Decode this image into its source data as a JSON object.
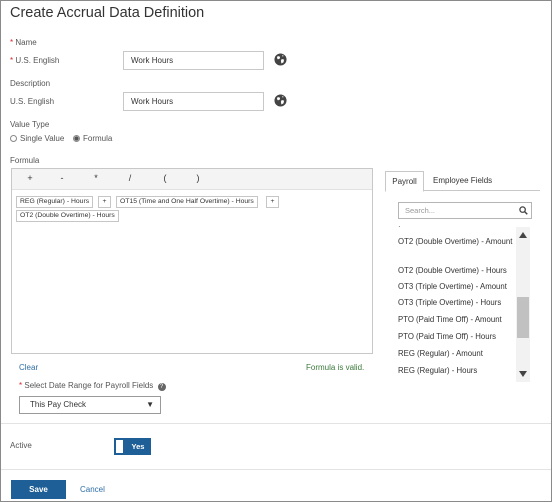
{
  "page": {
    "title": "Create Accrual Data Definition"
  },
  "name": {
    "section_label": "Name",
    "field_label": "U.S. English",
    "value": "Work Hours"
  },
  "description": {
    "section_label": "Description",
    "field_label": "U.S. English",
    "value": "Work Hours"
  },
  "value_type": {
    "label": "Value Type",
    "options": [
      "Single Value",
      "Formula"
    ],
    "selected": "Formula"
  },
  "formula": {
    "label": "Formula",
    "operators": [
      "+",
      "-",
      "*",
      "/",
      "(",
      ")"
    ],
    "tokens": [
      "REG (Regular) - Hours",
      "+",
      "OT15 (Time and One Half Overtime) - Hours",
      "+",
      "OT2 (Double Overtime) - Hours"
    ],
    "clear_label": "Clear",
    "status": "Formula is valid."
  },
  "date_range": {
    "label": "Select Date Range for Payroll Fields",
    "help": "?",
    "value": "This Pay Check",
    "caret": "▼"
  },
  "field_panel": {
    "tabs": [
      "Payroll",
      "Employee Fields"
    ],
    "active_tab": "Payroll",
    "search_placeholder": "Search...",
    "partial_item": "·",
    "items": [
      "OT2 (Double Overtime) - Amount",
      "OT2 (Double Overtime) - Hours",
      "OT3 (Triple Overtime) - Amount",
      "OT3 (Triple Overtime) - Hours",
      "PTO (Paid Time Off) - Amount",
      "PTO (Paid Time Off) - Hours",
      "REG (Regular) - Amount",
      "REG (Regular) - Hours"
    ]
  },
  "active": {
    "label": "Active",
    "toggle_text": "Yes",
    "is_on": true
  },
  "footer": {
    "save_label": "Save",
    "cancel_label": "Cancel"
  },
  "colors": {
    "primary": "#1f5f97",
    "required": "#d9232d",
    "link": "#2f6ea6",
    "valid": "#3b7a3b"
  },
  "icons": [
    "globe-icon",
    "search-icon",
    "scroll-up-icon",
    "scroll-down-icon",
    "help-icon",
    "dropdown-caret-icon"
  ]
}
